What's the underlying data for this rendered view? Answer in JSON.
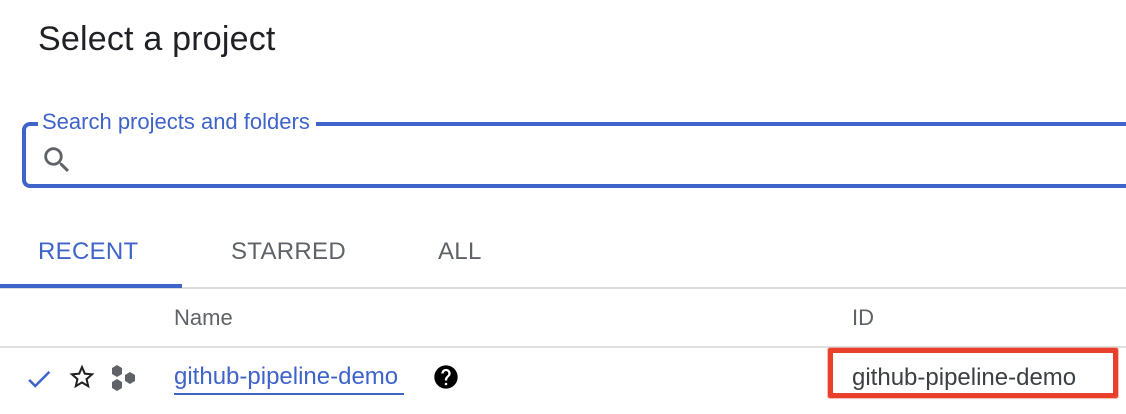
{
  "dialog": {
    "title": "Select a project"
  },
  "search": {
    "label": "Search projects and folders",
    "value": "",
    "placeholder": ""
  },
  "tabs": [
    {
      "label": "RECENT",
      "active": true
    },
    {
      "label": "STARRED",
      "active": false
    },
    {
      "label": "ALL",
      "active": false
    }
  ],
  "table": {
    "columns": [
      "Name",
      "ID"
    ],
    "rows": [
      {
        "selected": true,
        "starred": false,
        "name": "github-pipeline-demo",
        "id": "github-pipeline-demo"
      }
    ]
  },
  "icons": {
    "search": "search-icon",
    "check": "check-icon",
    "star": "star-outline-icon",
    "project": "project-hexagons-icon",
    "help": "help-circle-icon"
  },
  "colors": {
    "accent": "#3f64c9",
    "highlight": "#e8402a",
    "muted_text": "#5f6368"
  }
}
